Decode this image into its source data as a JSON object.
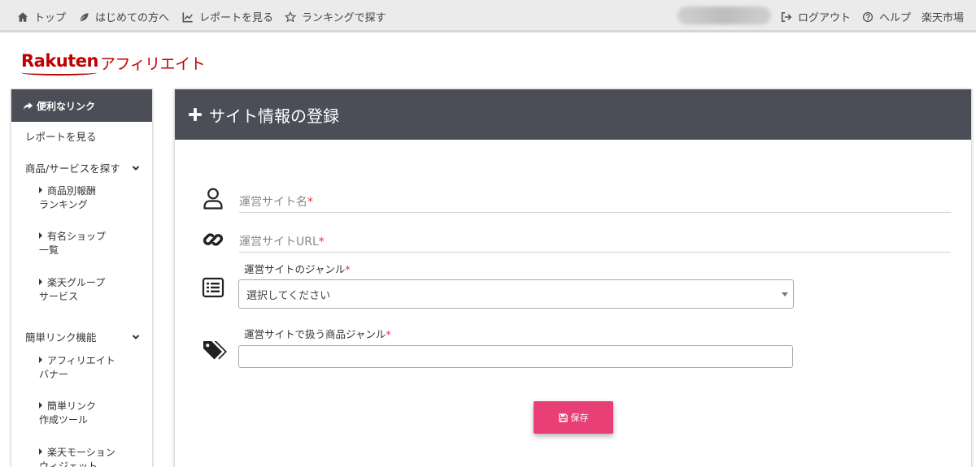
{
  "nav": {
    "top": "トップ",
    "beginners": "はじめての方へ",
    "report": "レポートを見る",
    "ranking": "ランキングで探す",
    "logout": "ログアウト",
    "help": "ヘルプ",
    "market": "楽天市場"
  },
  "logo": {
    "brand": "Rakuten",
    "sub": "アフィリエイト"
  },
  "sidebar": {
    "header": "便利なリンク",
    "report": "レポートを見る",
    "search_group": "商品/サービスを探す",
    "ranking_l1": "商品別報酬",
    "ranking_l2": "ランキング",
    "shop_l1": "有名ショップ",
    "shop_l2": "一覧",
    "group_l1": "楽天グループ",
    "group_l2": "サービス",
    "easy_group": "簡単リンク機能",
    "banner_l1": "アフィリエイト",
    "banner_l2": "バナー",
    "tool_l1": "簡単リンク",
    "tool_l2": "作成ツール",
    "widget_l1": "楽天モーション",
    "widget_l2": "ウィジェット"
  },
  "form": {
    "title": "サイト情報の登録",
    "site_name": "運営サイト名",
    "site_url": "運営サイトURL",
    "genre_label": "運営サイトのジャンル",
    "genre_select": "選択してください",
    "product_genre_label": "運営サイトで扱う商品ジャンル",
    "required_mark": "*",
    "save": "保存"
  },
  "colors": {
    "accent": "#e83f76",
    "brand": "#bf0000",
    "header_bg": "#4b4e56",
    "required": "#d9333f"
  }
}
